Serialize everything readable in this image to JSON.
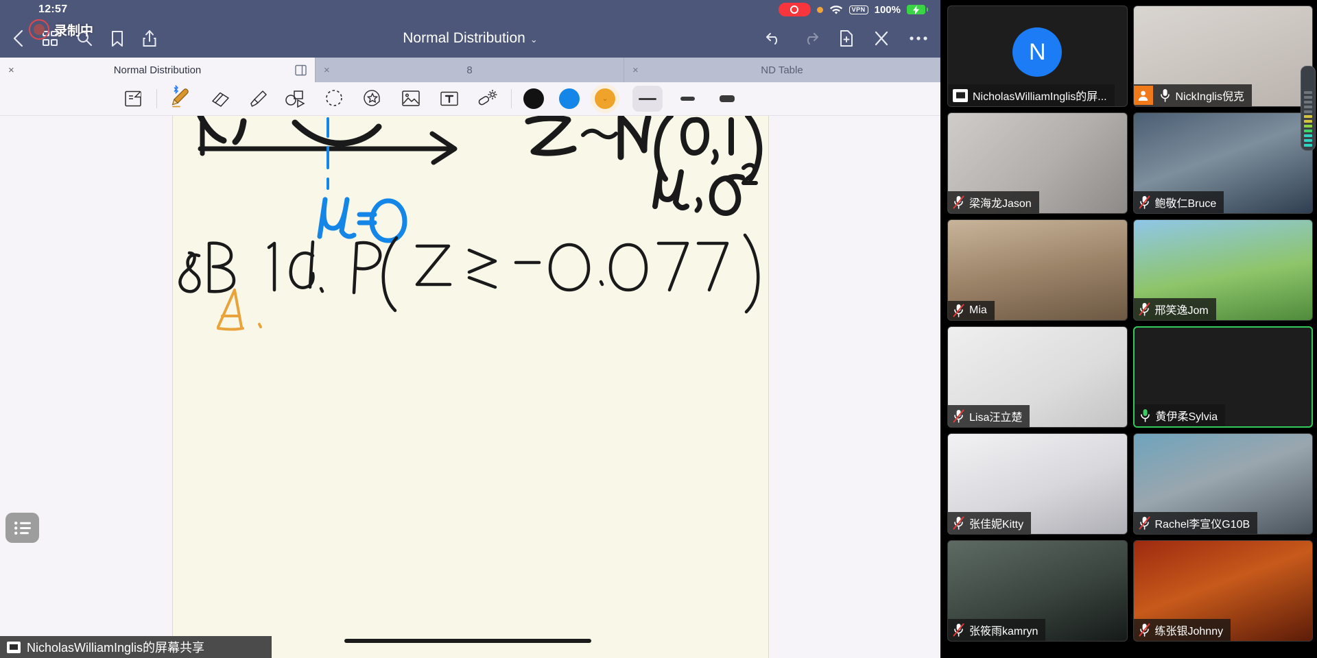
{
  "status_bar": {
    "time": "12:57",
    "recording_indicator": "rec-pill-icon",
    "privacy_dot": "orange-dot-icon",
    "wifi": "wifi-icon",
    "vpn_label": "VPN",
    "battery_percent": "100%",
    "battery_state": "charging"
  },
  "recording_badge": {
    "label": "录制中"
  },
  "navbar": {
    "back": "back-chevron-icon",
    "grid": "grid-icon",
    "search": "search-icon",
    "bookmark": "bookmark-icon",
    "share": "share-icon",
    "title": "Normal Distribution",
    "title_chevron": "⌄",
    "undo": "undo-icon",
    "redo": "redo-icon",
    "add_page": "add-page-icon",
    "close": "close-icon",
    "more": "more-icon"
  },
  "tabs": [
    {
      "label": "Normal Distribution",
      "close": "×",
      "active": true,
      "split": "split-view-icon"
    },
    {
      "label": "8",
      "close": "×",
      "active": false
    },
    {
      "label": "ND Table",
      "close": "×",
      "active": false
    }
  ],
  "toolbar": {
    "tools": [
      {
        "name": "page-flip-tool",
        "selected": false
      },
      {
        "name": "pen-tool",
        "selected": true,
        "badge": "bluetooth-icon"
      },
      {
        "name": "eraser-tool",
        "selected": false
      },
      {
        "name": "highlighter-tool",
        "selected": false
      },
      {
        "name": "shape-tool",
        "selected": false
      },
      {
        "name": "lasso-tool",
        "selected": false
      },
      {
        "name": "sticker-tool",
        "selected": false
      },
      {
        "name": "image-tool",
        "selected": false
      },
      {
        "name": "text-tool",
        "selected": false
      },
      {
        "name": "magic-tool",
        "selected": false
      }
    ],
    "colors": [
      {
        "name": "black",
        "hex": "#121212",
        "selected": false
      },
      {
        "name": "blue",
        "hex": "#1486E8",
        "selected": false
      },
      {
        "name": "orange",
        "hex": "#F0A32A",
        "selected": true
      }
    ],
    "widths": [
      {
        "name": "thin",
        "selected": true
      },
      {
        "name": "medium",
        "selected": false
      },
      {
        "name": "thick",
        "selected": false
      }
    ]
  },
  "canvas": {
    "notes": [
      {
        "id": "axis-diagram",
        "text": "normal curve with horizontal axis and arrow",
        "color": "#1a1a1a"
      },
      {
        "id": "mu-label",
        "text": "μ=0",
        "color": "#1486E8"
      },
      {
        "id": "distribution",
        "text": "Z ~ N(0,1)",
        "color": "#1a1a1a"
      },
      {
        "id": "params",
        "text": "μ, σ²",
        "color": "#1a1a1a"
      },
      {
        "id": "question",
        "text": "8B  1d.  P(Z ≥ -0.077)",
        "color": "#1a1a1a"
      },
      {
        "id": "answer",
        "text": "A",
        "color": "#E8A33D"
      }
    ],
    "outline_button": "outline-list-icon",
    "scrollbar": "horizontal-scrollbar"
  },
  "share_banner": {
    "icon": "screen-share-icon",
    "label": "NicholasWilliamInglis的屏幕共享"
  },
  "participants": [
    {
      "name": "NicholasWilliamInglis的屏...",
      "muted": false,
      "sharing": true,
      "avatar_letter": "N",
      "avatar_color": "#1B7CF5",
      "speaking": false,
      "bg": "bg-nick-avatar"
    },
    {
      "name": "NickInglis倪克",
      "muted": false,
      "person_chip": true,
      "speaking": false,
      "bg": "bg-nick"
    },
    {
      "name": "梁海龙Jason",
      "muted": true,
      "speaking": false,
      "bg": "bg-jason"
    },
    {
      "name": "鲍敬仁Bruce",
      "muted": true,
      "speaking": false,
      "bg": "bg-bruce"
    },
    {
      "name": "Mia",
      "muted": true,
      "speaking": false,
      "bg": "bg-mia"
    },
    {
      "name": "邢笑逸Jom",
      "muted": true,
      "speaking": false,
      "bg": "bg-jom"
    },
    {
      "name": "Lisa汪立楚",
      "muted": true,
      "speaking": false,
      "bg": "bg-lisa"
    },
    {
      "name": "黄伊柔Sylvia",
      "muted": false,
      "speaking": true,
      "bg": "bg-sylvia"
    },
    {
      "name": "张佳妮Kitty",
      "muted": true,
      "speaking": false,
      "bg": "bg-kitty"
    },
    {
      "name": "Rachel李宣仪G10B",
      "muted": true,
      "speaking": false,
      "bg": "bg-rachel"
    },
    {
      "name": "张筱雨kamryn",
      "muted": true,
      "speaking": false,
      "bg": "bg-kamryn"
    },
    {
      "name": "练张银Johnny",
      "muted": true,
      "speaking": false,
      "bg": "bg-johnny"
    }
  ],
  "volume_meter": {
    "name": "audio-level-meter",
    "level": 9
  }
}
